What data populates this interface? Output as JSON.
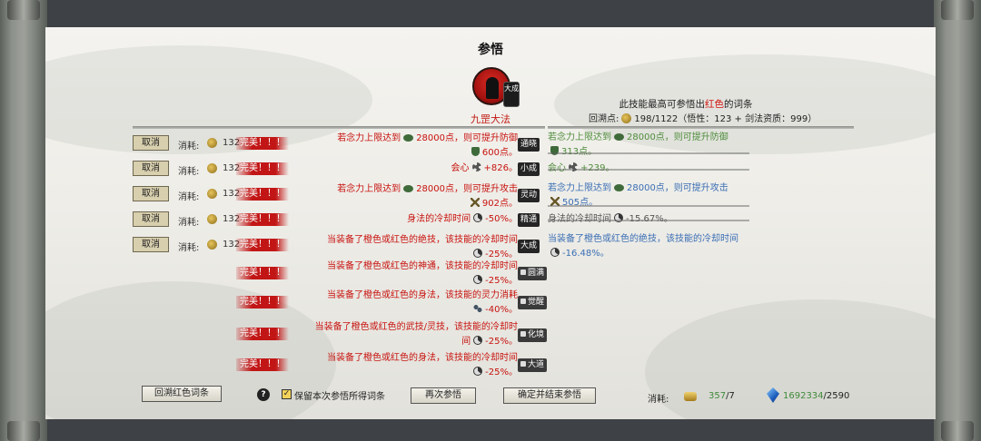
{
  "panel": {
    "title": "参悟"
  },
  "skill": {
    "name": "九罡大法",
    "grade_badge": "大成",
    "icon": "warrior-silhouette-icon"
  },
  "info": {
    "red_text_pre": "此技能最高可参悟出",
    "red_text_red": "红色",
    "red_text_post": "的词条",
    "recall_label": "回溯点:",
    "recall_value": "198/1122（悟性：123 + 剑法资质：999）"
  },
  "rows": [
    {
      "cancel": "取消",
      "cost_label": "消耗:",
      "cost": "132",
      "perfect": "完美！！！",
      "effect_l1": "若念力上限达到",
      "effect_num": "28000点，则可提升防御",
      "effect_l2": "600点。",
      "tier": "通晓",
      "prev_l1": "若念力上限达到",
      "prev_num": "28000点，则可提升防御",
      "prev_l2": "313点。",
      "prev_color": "green"
    },
    {
      "cancel": "取消",
      "cost_label": "消耗:",
      "cost": "132",
      "perfect": "完美！！！",
      "effect_l1": "会心",
      "effect_num": "+826。",
      "tier": "小成",
      "prev_l1": "会心",
      "prev_num": "+239。",
      "prev_color": "green"
    },
    {
      "cancel": "取消",
      "cost_label": "消耗:",
      "cost": "132",
      "perfect": "完美！！！",
      "effect_l1": "若念力上限达到",
      "effect_num": "28000点，则可提升攻击",
      "effect_l2": "902点。",
      "tier": "灵动",
      "prev_l1": "若念力上限达到",
      "prev_num": "28000点，则可提升攻击",
      "prev_l2": "505点。",
      "prev_color": "blue"
    },
    {
      "cancel": "取消",
      "cost_label": "消耗:",
      "cost": "132",
      "perfect": "完美！！！",
      "effect_l1": "身法的冷却时间",
      "effect_num": "-50%。",
      "tier": "精通",
      "prev_l1": "身法的冷却时间",
      "prev_num": "-15.67%。",
      "prev_color": "gray"
    },
    {
      "cancel": "取消",
      "cost_label": "消耗:",
      "cost": "132",
      "perfect": "完美！！！",
      "effect_l1": "当装备了橙色或红色的绝技，该技能的冷却时间",
      "effect_l2": "-25%。",
      "tier": "大成",
      "prev_l1": "当装备了橙色或红色的绝技，该技能的冷却时间",
      "prev_l2": "-16.48%。",
      "prev_color": "blue"
    },
    {
      "perfect": "完美！！！",
      "effect_l1": "当装备了橙色或红色的神通，该技能的冷却时间",
      "effect_l2": "-25%。",
      "tier": "圆满"
    },
    {
      "perfect": "完美！！！",
      "effect_l1": "当装备了橙色或红色的身法，该技能的灵力消耗",
      "effect_l2": "-40%。",
      "tier": "觉醒"
    },
    {
      "perfect": "完美！！！",
      "effect_l1": "当装备了橙色或红色的武技/灵技，该技能的冷却时",
      "effect_l1b": "间",
      "effect_l2": "-25%。",
      "tier": "化境"
    },
    {
      "perfect": "完美！！！",
      "effect_l1": "当装备了橙色或红色的身法，该技能的冷却时间",
      "effect_l2": "-25%。",
      "tier": "大道"
    }
  ],
  "footer": {
    "recall_red_button": "回溯红色词条",
    "help": "?",
    "keep_checkbox_label": "保留本次参悟所得词条",
    "keep_checked": true,
    "again_button": "再次参悟",
    "confirm_button": "确定并结束参悟",
    "cost_label": "消耗:",
    "gold_have": "357",
    "gold_need": "/7",
    "gem_have": "1692334",
    "gem_need": "/2590"
  },
  "colors": {
    "red": "#c8120e",
    "green": "#4f8d3c",
    "blue": "#3a6eb4",
    "perfect_bg": "#c21616"
  }
}
